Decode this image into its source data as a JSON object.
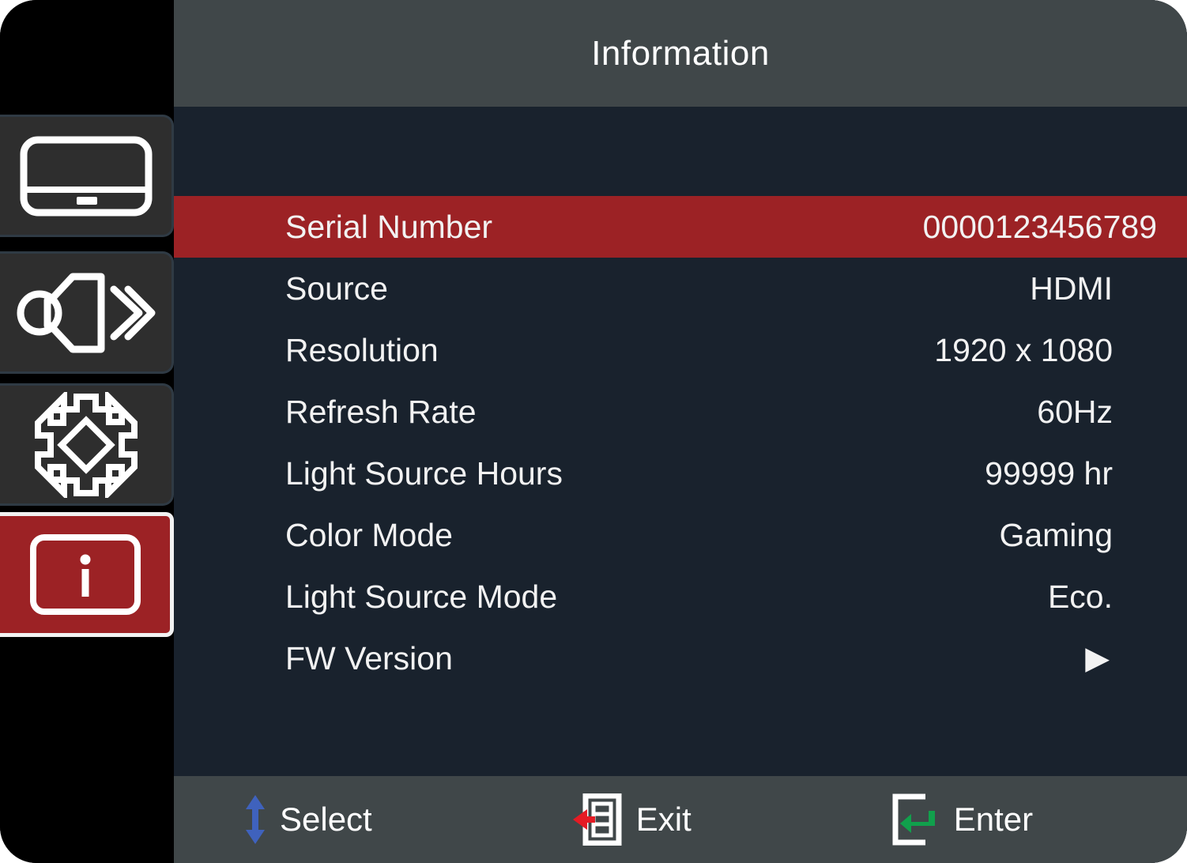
{
  "window": {
    "kind": "projector-osd-menu",
    "title": "Information"
  },
  "colors": {
    "highlight_red": "#9c2225",
    "panel_background": "#19222d",
    "bar_background": "#404749",
    "rail_background": "#000000",
    "tile_background": "#2e2e2e",
    "text": "#f2f2f2",
    "select_arrow_blue": "#3f62bd",
    "exit_arrow_red": "#e51b24",
    "enter_arrow_green": "#11a04c"
  },
  "sidebar": {
    "items": [
      {
        "label": "Display",
        "icon": "display-screen-icon",
        "selected": false
      },
      {
        "label": "Audio",
        "icon": "speaker-volume-icon",
        "selected": false
      },
      {
        "label": "Settings",
        "icon": "gear-icon",
        "selected": false
      },
      {
        "label": "Information",
        "icon": "info-icon",
        "selected": true
      }
    ]
  },
  "main": {
    "rows": [
      {
        "label": "Serial Number",
        "value": "0000123456789",
        "highlighted": true,
        "type": "text"
      },
      {
        "label": "Source",
        "value": "HDMI",
        "highlighted": false,
        "type": "text"
      },
      {
        "label": "Resolution",
        "value": "1920 x 1080",
        "highlighted": false,
        "type": "text"
      },
      {
        "label": "Refresh Rate",
        "value": "60Hz",
        "highlighted": false,
        "type": "text"
      },
      {
        "label": "Light Source Hours",
        "value": "99999 hr",
        "highlighted": false,
        "type": "text"
      },
      {
        "label": "Color Mode",
        "value": "Gaming",
        "highlighted": false,
        "type": "text"
      },
      {
        "label": "Light Source Mode",
        "value": "Eco.",
        "highlighted": false,
        "type": "text"
      },
      {
        "label": "FW Version",
        "value": "▶",
        "highlighted": false,
        "type": "submenu"
      }
    ]
  },
  "footer": {
    "hints": [
      {
        "label": "Select",
        "icon": "up-down-arrow-icon"
      },
      {
        "label": "Exit",
        "icon": "menu-back-icon"
      },
      {
        "label": "Enter",
        "icon": "enter-return-icon"
      }
    ]
  }
}
